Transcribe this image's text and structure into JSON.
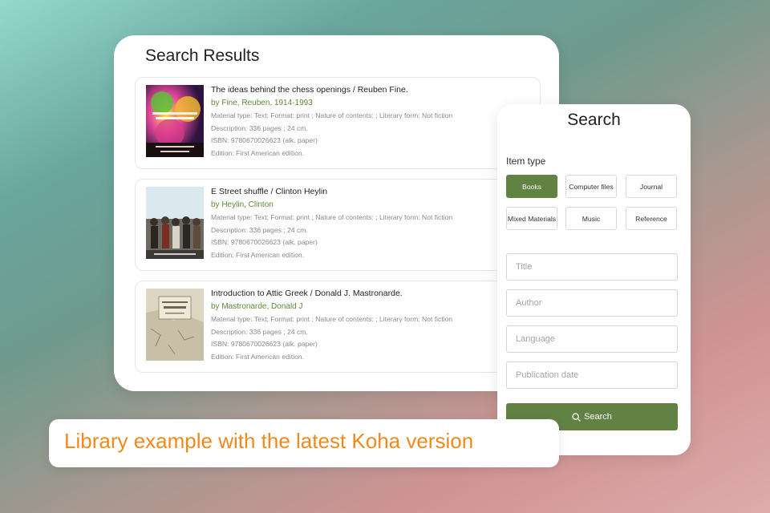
{
  "results_panel": {
    "title": "Search Results",
    "results": [
      {
        "title": "The ideas behind the chess openings / Reuben Fine.",
        "author": "by Fine, Reuben, 1914-1993",
        "material": "Material type: Text; Format: print ; Nature of contents: ; Literary form: Not fiction",
        "description": "Description: 336 pages ; 24 cm.",
        "isbn": "ISBN: 9780670026623 (alk. paper)",
        "edition": "Edition: First American edition."
      },
      {
        "title": "E Street shuffle / Clinton Heylin",
        "author": "by Heylin, Clinton",
        "material": "Material type: Text; Format: print ; Nature of contents: ; Literary form: Not fiction",
        "description": "Description: 336 pages ; 24 cm.",
        "isbn": "ISBN: 9780670026623 (alk. paper)",
        "edition": "Edition: First American edition."
      },
      {
        "title": "Introduction to Attic Greek / Donald J. Mastronarde.",
        "author": "by Mastronarde, Donald J",
        "material": "Material type: Text; Format: print ; Nature of contents: ; Literary form: Not fiction",
        "description": "Description: 336 pages ; 24 cm.",
        "isbn": "ISBN: 9780670026623 (alk. paper)",
        "edition": "Edition: First American edition."
      }
    ]
  },
  "search_panel": {
    "title": "Search",
    "item_type_label": "Item type",
    "item_types": [
      "Books",
      "Computer files",
      "Journal",
      "Mixed Materials",
      "Music",
      "Reference"
    ],
    "selected_item_type": "Books",
    "fields": {
      "title_placeholder": "Title",
      "author_placeholder": "Author",
      "language_placeholder": "Language",
      "pubdate_placeholder": "Publication date"
    },
    "search_button": "Search",
    "search_icon": "magnifier-icon"
  },
  "banner": {
    "text": "Library example with the latest Koha version"
  },
  "colors": {
    "accent_green": "#628244",
    "author_green": "#5e8a37",
    "banner_orange": "#f08a1c"
  }
}
